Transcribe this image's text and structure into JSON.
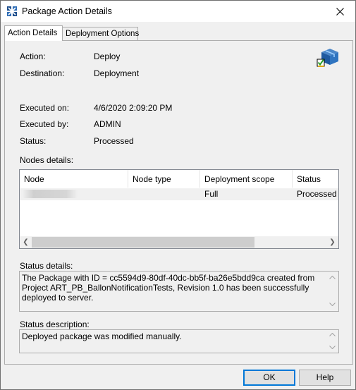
{
  "window": {
    "title": "Package Action Details",
    "close_symbol": "✕"
  },
  "tabs": [
    {
      "label": "Action Details",
      "active": true
    },
    {
      "label": "Deployment Options",
      "active": false
    }
  ],
  "details": {
    "action_label": "Action:",
    "action_value": "Deploy",
    "destination_label": "Destination:",
    "destination_value": "Deployment",
    "executed_on_label": "Executed on:",
    "executed_on_value": "4/6/2020 2:09:20 PM",
    "executed_by_label": "Executed by:",
    "executed_by_value": "ADMIN",
    "status_label": "Status:",
    "status_value": "Processed"
  },
  "nodes": {
    "label": "Nodes details:",
    "columns": [
      "Node",
      "Node type",
      "Deployment scope",
      "Status"
    ],
    "rows": [
      {
        "node": "",
        "node_type": "",
        "scope": "Full",
        "status": "Processed"
      }
    ],
    "scroll_left": "❮",
    "scroll_right": "❯"
  },
  "status_details": {
    "label": "Status details:",
    "text": "The Package with ID = cc5594d9-80df-40dc-bb5f-ba26e5bdd9ca created from Project ART_PB_BallonNotificationTests, Revision 1.0 has been successfully deployed to server."
  },
  "status_description": {
    "label": "Status description:",
    "text": "Deployed package was modified manually."
  },
  "buttons": {
    "ok": "OK",
    "help": "Help"
  },
  "icons": {
    "title_icon": "package-icon",
    "package_icon": "deploy-package-icon"
  },
  "colors": {
    "accent": "#0078d7",
    "window_bg": "#f0f0f0"
  }
}
